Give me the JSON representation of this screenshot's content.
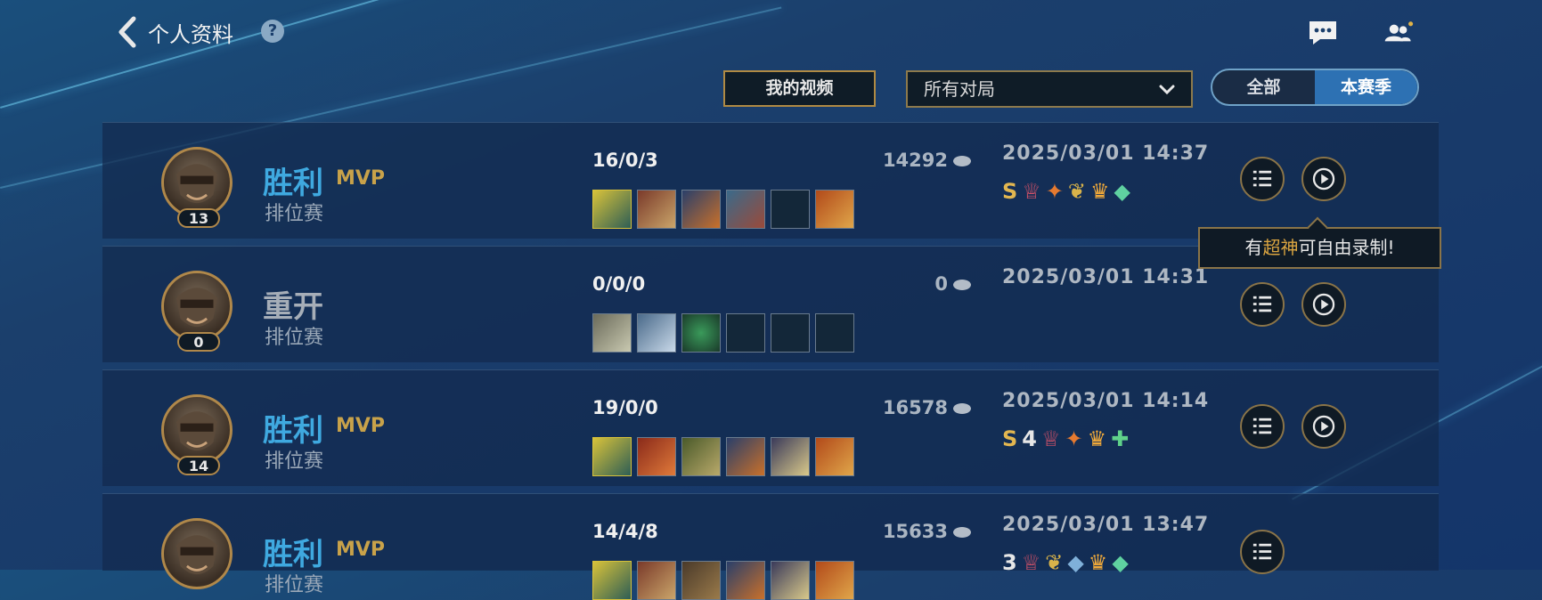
{
  "header": {
    "title": "个人资料",
    "help_icon": "?",
    "my_videos_label": "我的视频",
    "filter_select": "所有对局",
    "season_toggle": [
      "全部",
      "本赛季"
    ],
    "season_active_index": 1
  },
  "tooltip": {
    "before": "有",
    "highlight": "超神",
    "after": "可自由录制!"
  },
  "matches": [
    {
      "level": "13",
      "result": "胜利",
      "mvp": "MVP",
      "mode": "排位赛",
      "kda": "16/0/3",
      "gold": "14292",
      "time": "2025/03/01 14:37",
      "badges": [
        "S",
        "♕",
        "✦",
        "❦",
        "♛",
        "◆"
      ],
      "items": 6,
      "result_type": "win"
    },
    {
      "level": "0",
      "result": "重开",
      "mvp": "",
      "mode": "排位赛",
      "kda": "0/0/0",
      "gold": "0",
      "time": "2025/03/01 14:31",
      "badges": [],
      "items": 3,
      "result_type": "remake"
    },
    {
      "level": "14",
      "result": "胜利",
      "mvp": "MVP",
      "mode": "排位赛",
      "kda": "19/0/0",
      "gold": "16578",
      "time": "2025/03/01 14:14",
      "badges": [
        "S",
        "4",
        "♕",
        "✦",
        "♛",
        "✚"
      ],
      "items": 6,
      "result_type": "win"
    },
    {
      "level": "",
      "result": "胜利",
      "mvp": "MVP",
      "mode": "排位赛",
      "kda": "14/4/8",
      "gold": "15633",
      "time": "2025/03/01 13:47",
      "badges": [
        "3",
        "♕",
        "❦",
        "◆",
        "♛",
        "◆"
      ],
      "items": 6,
      "result_type": "win"
    }
  ],
  "colors": {
    "win": "#3fa9e0",
    "mvp": "#c8a24a",
    "accent_gold": "#b08a43"
  }
}
